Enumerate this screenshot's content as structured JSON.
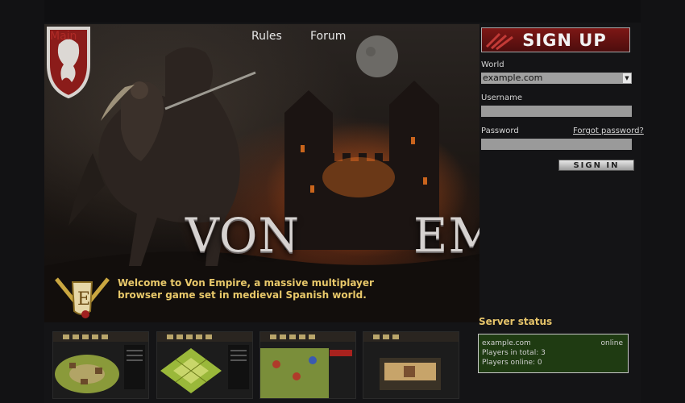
{
  "nav": {
    "main": "Main",
    "rules": "Rules",
    "forum": "Forum"
  },
  "signup": {
    "label": "SIGN UP"
  },
  "login": {
    "world_label": "World",
    "world_value": "example.com",
    "username_label": "Username",
    "username_value": "",
    "password_label": "Password",
    "password_value": "",
    "forgot_label": "Forgot password?",
    "signin_label": "SIGN IN"
  },
  "logo": {
    "left": "VON",
    "right": "EMPIRE"
  },
  "welcome": {
    "text": "Welcome to Von Empire, a massive multiplayer browser game set in medieval Spanish world."
  },
  "server": {
    "title": "Server status",
    "name": "example.com",
    "state": "online",
    "players_total": "Players in total: 3",
    "players_online": "Players online: 0"
  },
  "screenshots": [
    {
      "name": "village-screenshot"
    },
    {
      "name": "map-screenshot"
    },
    {
      "name": "battle-screenshot"
    },
    {
      "name": "building-screenshot"
    }
  ],
  "colors": {
    "accent_red": "#b02a26",
    "gold_text": "#e8c86a",
    "server_bg": "#1f3b12",
    "background": "#0f0f11"
  }
}
